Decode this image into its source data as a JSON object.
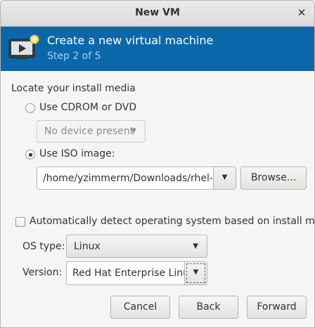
{
  "window": {
    "title": "New VM",
    "close_glyph": "✕"
  },
  "banner": {
    "heading": "Create a new virtual machine",
    "step": "Step 2 of 5",
    "icon": "vm-screen-icon"
  },
  "media": {
    "section_label": "Locate your install media",
    "cdrom_label": "Use CDROM or DVD",
    "cdrom_device": "No device present",
    "iso_label": "Use ISO image:",
    "iso_path": "/home/yzimmerm/Downloads/rhel-w",
    "browse_label": "Browse..."
  },
  "os": {
    "auto_detect_label": "Automatically detect operating system based on install media",
    "type_label": "OS type:",
    "type_value": "Linux",
    "version_label": "Version:",
    "version_value": "Red Hat Enterprise Linu"
  },
  "footer": {
    "cancel_label": "Cancel",
    "back_label": "Back",
    "forward_label": "Forward"
  },
  "colors": {
    "banner": "#0a68aa",
    "step_text": "#9fd0f5"
  }
}
